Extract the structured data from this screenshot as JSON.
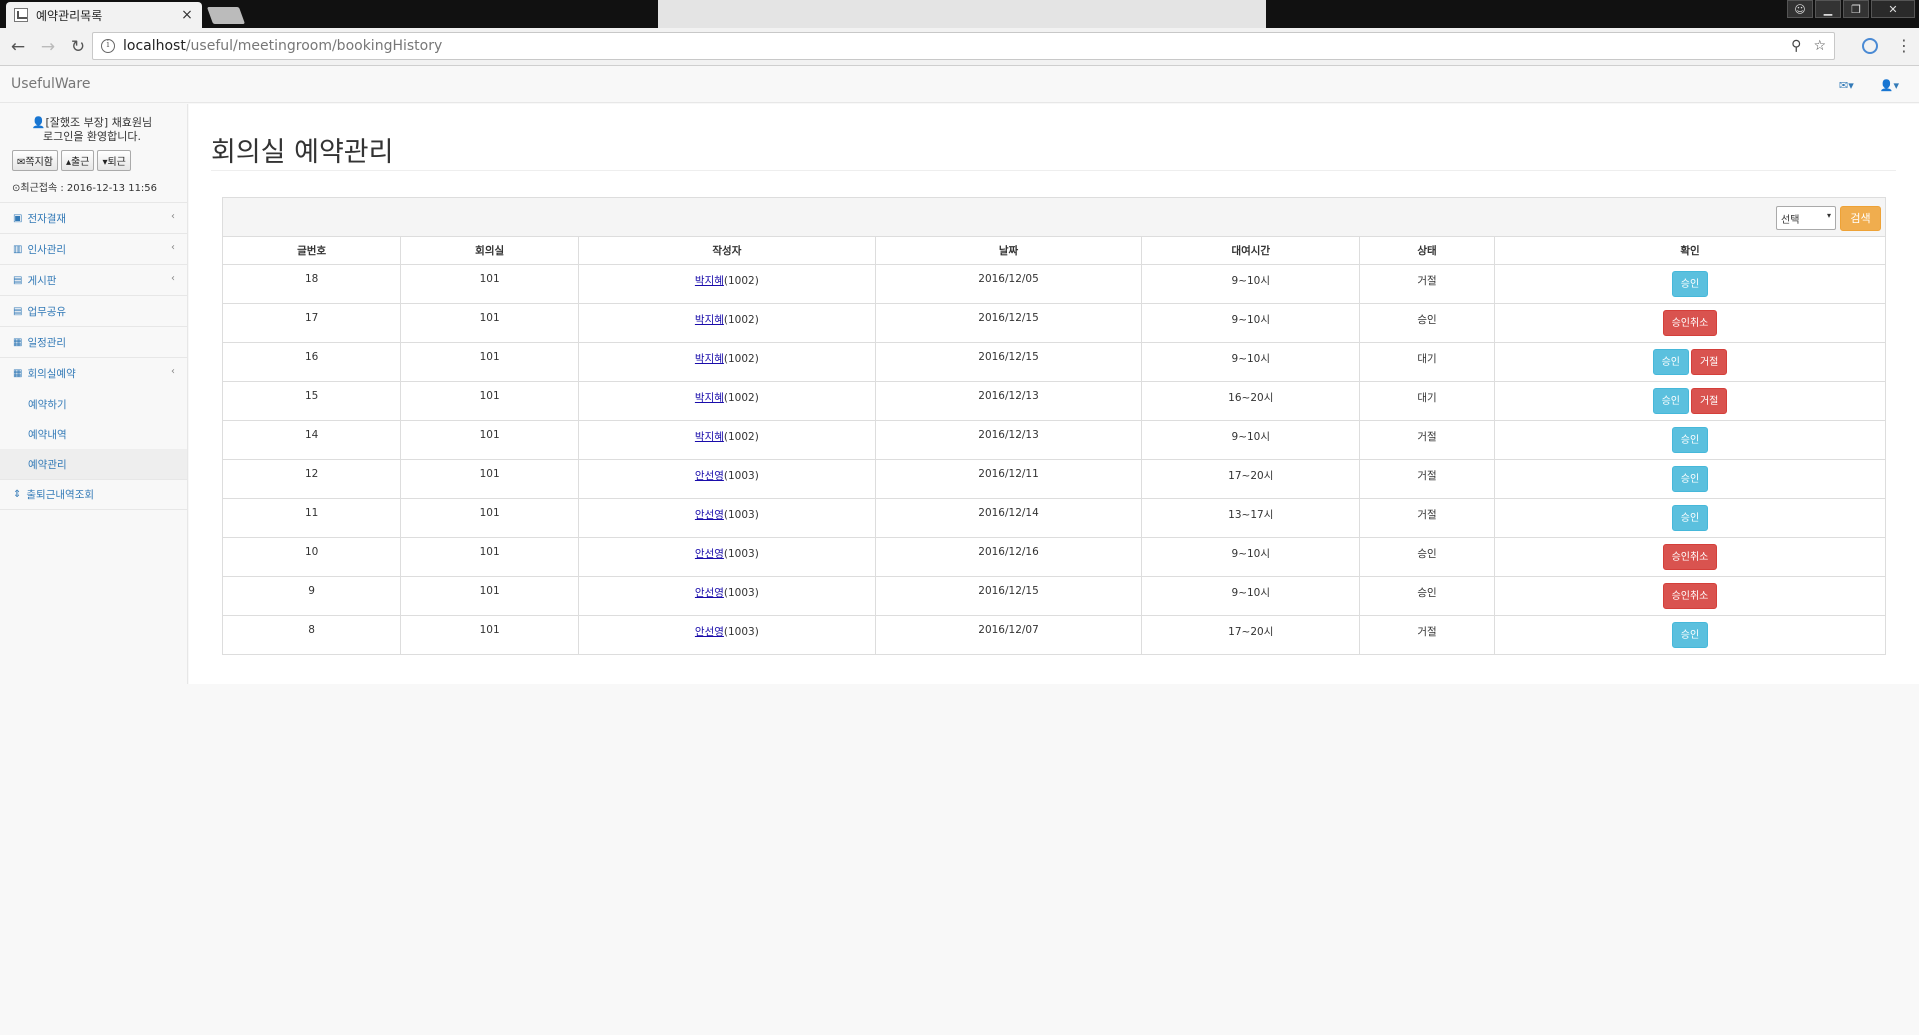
{
  "browser": {
    "tab_title": "예약관리목록",
    "tab_close": "×",
    "url_host": "localhost",
    "url_path": "/useful/meetingroom/bookingHistory"
  },
  "app": {
    "brand": "UsefulWare"
  },
  "sidebar": {
    "welcome_line1": "[잘했조 부장] 채효원님",
    "welcome_line2": "로그인을 환영합니다.",
    "btn_message": "쪽지함",
    "btn_checkin": "출근",
    "btn_checkout": "퇴근",
    "last_login": "최근접속 : 2016-12-13 11:56",
    "menu": [
      {
        "label": "전자결재",
        "icon": "file-icon",
        "glyph": "▣",
        "has_chevron": true
      },
      {
        "label": "인사관리",
        "icon": "bar-chart-icon",
        "glyph": "▥",
        "has_chevron": true
      },
      {
        "label": "게시판",
        "icon": "table-icon",
        "glyph": "▤",
        "has_chevron": true
      },
      {
        "label": "업무공유",
        "icon": "list-icon",
        "glyph": "▤",
        "has_chevron": false
      },
      {
        "label": "일정관리",
        "icon": "calendar-icon",
        "glyph": "▦",
        "has_chevron": false
      },
      {
        "label": "회의실예약",
        "icon": "calendar-icon",
        "glyph": "▦",
        "has_chevron": true
      }
    ],
    "submenu": [
      "예약하기",
      "예약내역",
      "예약관리"
    ],
    "attendance": "출퇴근내역조회"
  },
  "main": {
    "title": "회의실 예약관리",
    "select_value": "선택",
    "search_label": "검색",
    "columns": [
      "글번호",
      "회의실",
      "작성자",
      "날짜",
      "대여시간",
      "상태",
      "확인"
    ],
    "rows": [
      {
        "no": "18",
        "room": "101",
        "author": "박지혜",
        "author_id": "(1002)",
        "date": "2016/12/05",
        "time": "9~10시",
        "status": "거절",
        "actions": [
          "승인"
        ]
      },
      {
        "no": "17",
        "room": "101",
        "author": "박지혜",
        "author_id": "(1002)",
        "date": "2016/12/15",
        "time": "9~10시",
        "status": "승인",
        "actions": [
          "승인취소"
        ]
      },
      {
        "no": "16",
        "room": "101",
        "author": "박지혜",
        "author_id": "(1002)",
        "date": "2016/12/15",
        "time": "9~10시",
        "status": "대기",
        "actions": [
          "승인",
          "거절"
        ]
      },
      {
        "no": "15",
        "room": "101",
        "author": "박지혜",
        "author_id": "(1002)",
        "date": "2016/12/13",
        "time": "16~20시",
        "status": "대기",
        "actions": [
          "승인",
          "거절"
        ]
      },
      {
        "no": "14",
        "room": "101",
        "author": "박지혜",
        "author_id": "(1002)",
        "date": "2016/12/13",
        "time": "9~10시",
        "status": "거절",
        "actions": [
          "승인"
        ]
      },
      {
        "no": "12",
        "room": "101",
        "author": "안선영",
        "author_id": "(1003)",
        "date": "2016/12/11",
        "time": "17~20시",
        "status": "거절",
        "actions": [
          "승인"
        ]
      },
      {
        "no": "11",
        "room": "101",
        "author": "안선영",
        "author_id": "(1003)",
        "date": "2016/12/14",
        "time": "13~17시",
        "status": "거절",
        "actions": [
          "승인"
        ]
      },
      {
        "no": "10",
        "room": "101",
        "author": "안선영",
        "author_id": "(1003)",
        "date": "2016/12/16",
        "time": "9~10시",
        "status": "승인",
        "actions": [
          "승인취소"
        ]
      },
      {
        "no": "9",
        "room": "101",
        "author": "안선영",
        "author_id": "(1003)",
        "date": "2016/12/15",
        "time": "9~10시",
        "status": "승인",
        "actions": [
          "승인취소"
        ]
      },
      {
        "no": "8",
        "room": "101",
        "author": "안선영",
        "author_id": "(1003)",
        "date": "2016/12/07",
        "time": "17~20시",
        "status": "거절",
        "actions": [
          "승인"
        ]
      }
    ]
  },
  "colors": {
    "info": "#5bc0de",
    "danger": "#d9534f",
    "warning": "#f0ad4e",
    "link": "#337ab7"
  }
}
